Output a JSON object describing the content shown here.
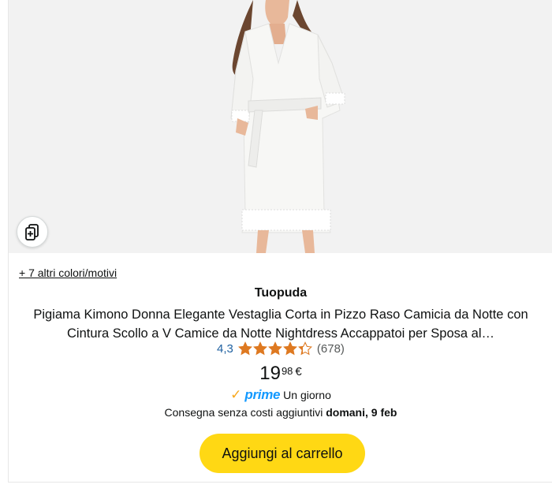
{
  "product": {
    "colors_link": "+ 7 altri colori/motivi",
    "brand": "Tuopuda",
    "title": "Pigiama Kimono Donna Elegante Vestaglia Corta in Pizzo Raso Camicia da Notte con Cintura Scollo a V Camice da Notte Nightdress Accappatoi per Sposa al…",
    "rating": {
      "value": "4,3",
      "stars": 4.3,
      "count": "(678)",
      "star_color": "#de7921"
    },
    "price": {
      "whole": "19",
      "fraction": "98",
      "currency": "€"
    },
    "prime": {
      "logo": "prime",
      "label": "Un giorno",
      "color": "#1399ff"
    },
    "delivery": {
      "prefix": "Consegna senza costi aggiuntivi",
      "date": "domani, 9 feb"
    },
    "cart_button": {
      "label": "Aggiungi al carrello",
      "color": "#ffd814"
    },
    "compare_icon": "compare-cards-icon"
  }
}
